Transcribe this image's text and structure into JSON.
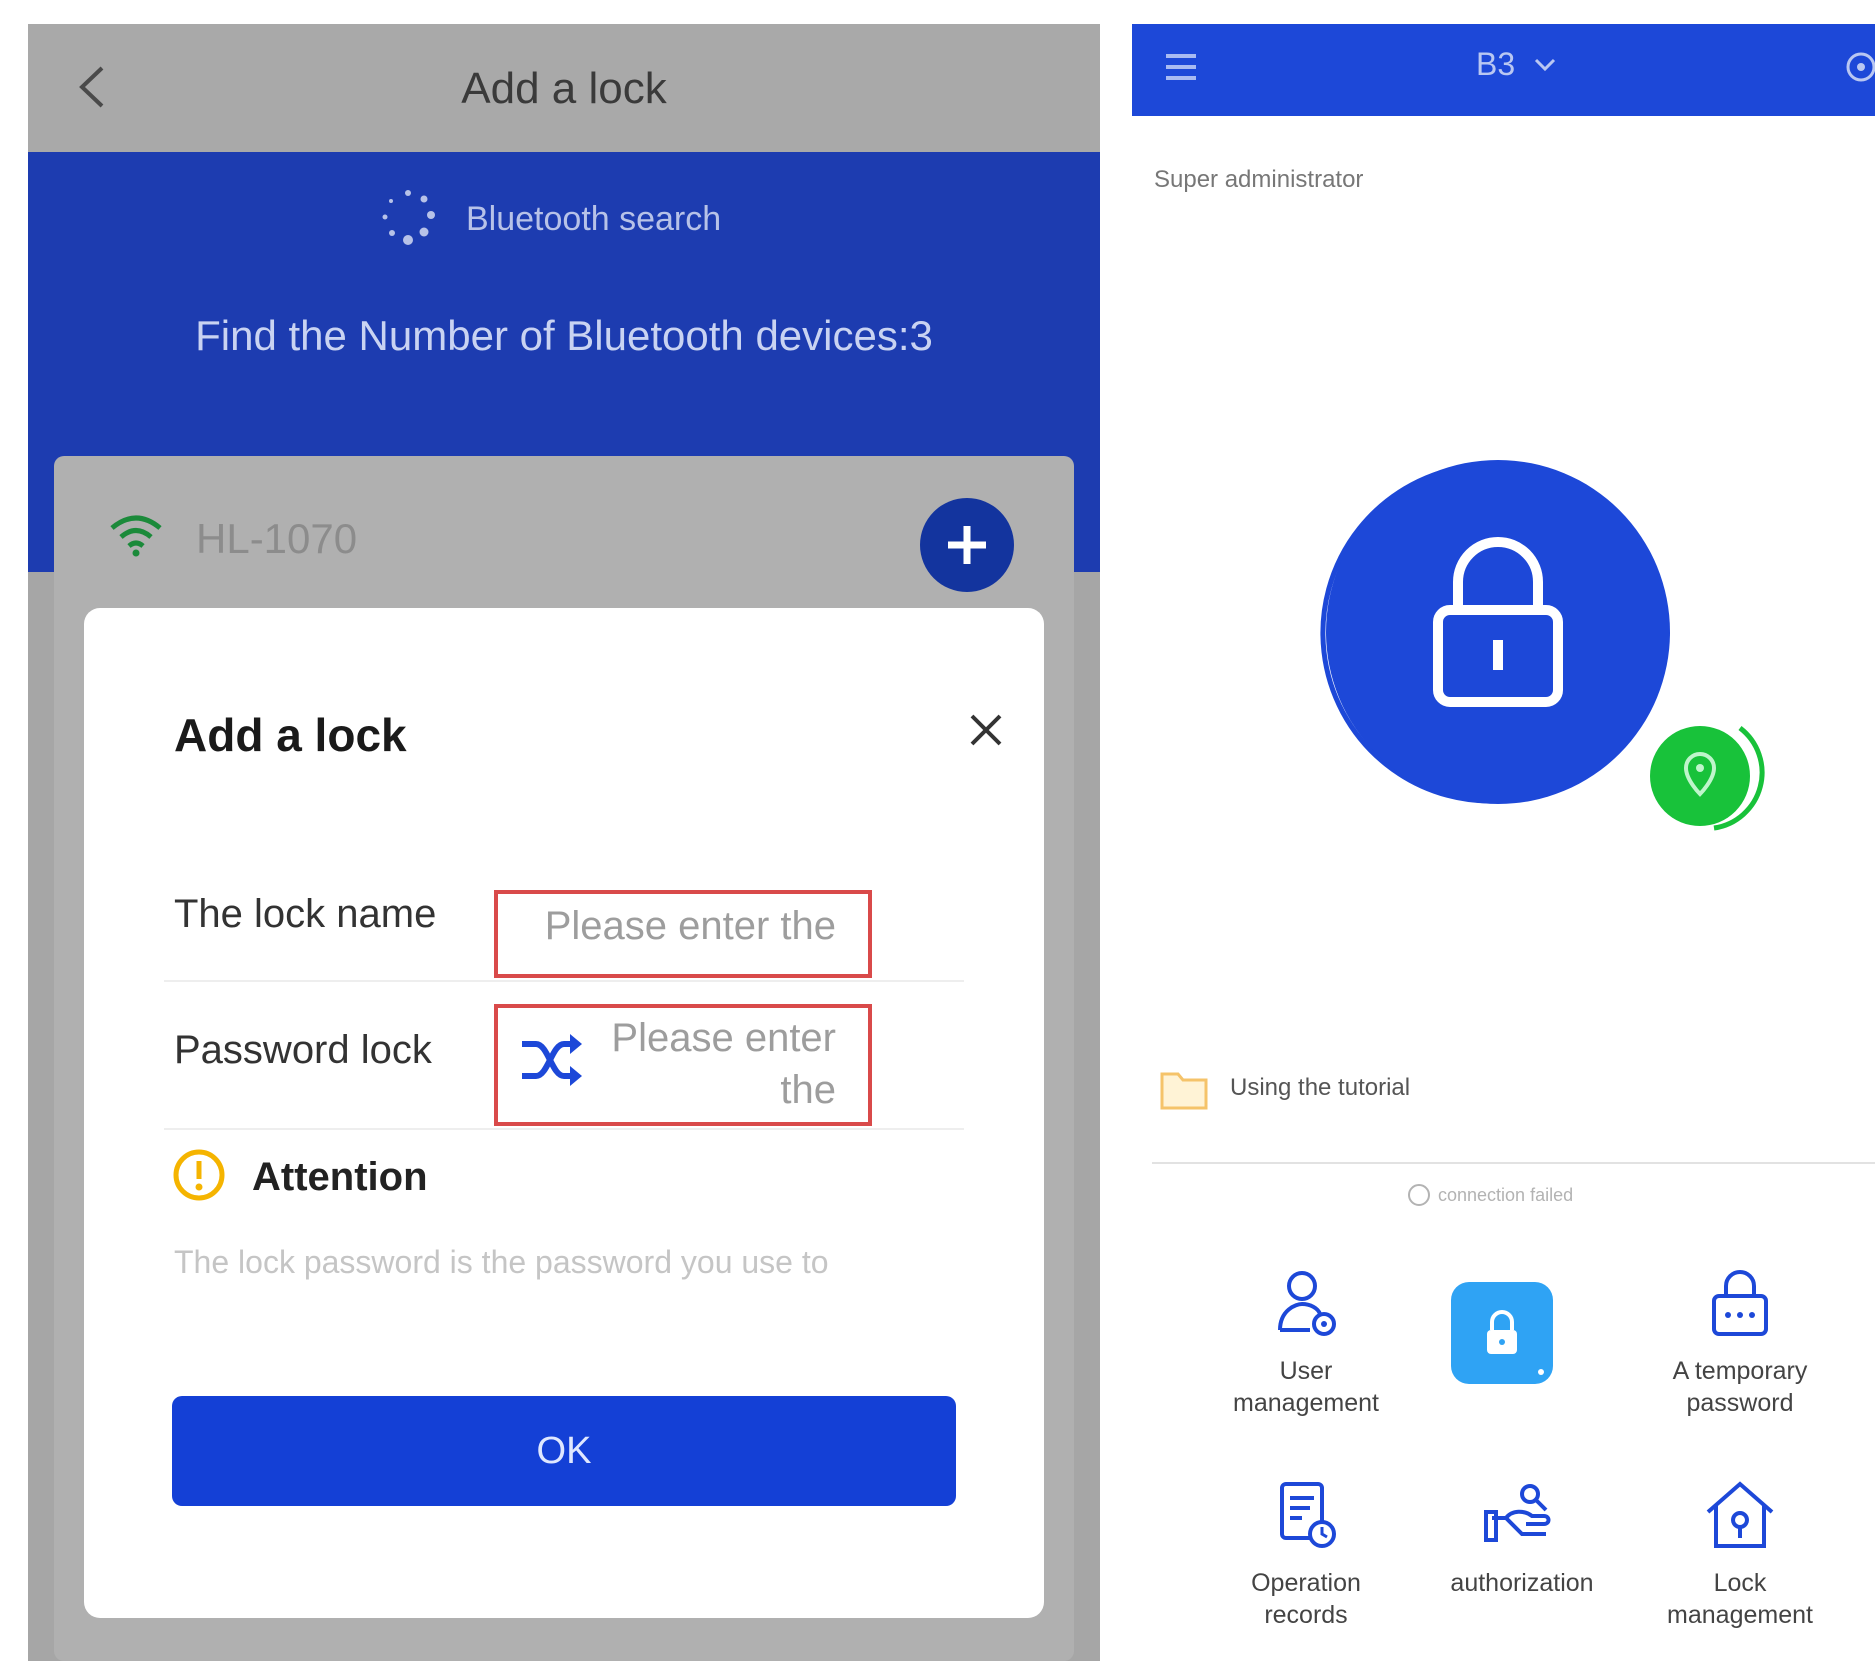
{
  "left_screen": {
    "title": "Add a lock",
    "search_label": "Bluetooth search",
    "found_text": "Find the Number of Bluetooth devices:3",
    "device_name": "HL-1070",
    "dialog": {
      "title": "Add a lock",
      "lock_name_label": "The lock name",
      "lock_name_placeholder": "Please enter the",
      "password_label": "Password lock",
      "password_placeholder_line1": "Please enter",
      "password_placeholder_line2": "the",
      "attention_title": "Attention",
      "attention_note": "The lock password is the password you use to",
      "ok_label": "OK"
    }
  },
  "right_screen": {
    "lock_selector": "B3",
    "role": "Super administrator",
    "tutorial_label": "Using the tutorial",
    "connection_status": "connection failed",
    "grid": [
      {
        "line1": "User",
        "line2": "management",
        "icon": "user-management-icon"
      },
      {
        "line1": "",
        "line2": "",
        "icon": "unlock-tile-icon"
      },
      {
        "line1": "A temporary",
        "line2": "password",
        "icon": "temporary-password-icon"
      },
      {
        "line1": "Operation",
        "line2": "records",
        "icon": "operation-records-icon"
      },
      {
        "line1": "authorization",
        "line2": "",
        "icon": "authorization-icon"
      },
      {
        "line1": "Lock",
        "line2": "management",
        "icon": "lock-management-icon"
      }
    ]
  },
  "colors": {
    "primary_blue": "#1d48d8",
    "dim_blue": "#1d3cb0",
    "green": "#18c23a",
    "field_border": "#d94a4a",
    "attention_yellow": "#f5b400"
  }
}
